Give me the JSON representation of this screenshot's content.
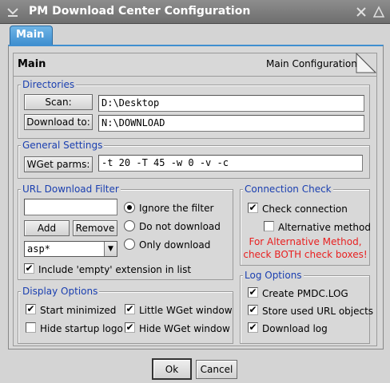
{
  "window": {
    "title": "PM Download Center Configuration"
  },
  "titlebar_icons": {
    "left": "chevron-down-icon",
    "close": "close-icon",
    "restore": "restore-icon"
  },
  "tabs": [
    {
      "label": "Main"
    }
  ],
  "main": {
    "heading": "Main",
    "section_label": "Main Configuration"
  },
  "directories": {
    "legend": "Directories",
    "scan_label": "Scan:",
    "scan_value": "D:\\Desktop",
    "download_label": "Download to:",
    "download_value": "N:\\DOWNLOAD"
  },
  "general": {
    "legend": "General Settings",
    "wget_label": "WGet parms:",
    "wget_value": "-t 20 -T 45 -w 0 -v -c"
  },
  "url_filter": {
    "legend": "URL Download Filter",
    "input_value": "",
    "add_label": "Add",
    "remove_label": "Remove",
    "select_value": "asp*",
    "radios": [
      {
        "label": "Ignore the filter",
        "checked": true
      },
      {
        "label": "Do not download",
        "checked": false
      },
      {
        "label": "Only download",
        "checked": false
      }
    ],
    "include_empty": {
      "label": "Include 'empty' extension in list",
      "checked": true
    }
  },
  "connection": {
    "legend": "Connection Check",
    "check_connection": {
      "label": "Check connection",
      "checked": true
    },
    "alternative": {
      "label": "Alternative method",
      "checked": false
    },
    "note_line1": "For Alternative Method,",
    "note_line2": "check BOTH check boxes!",
    "note_color": "#e82020"
  },
  "display": {
    "legend": "Display Options",
    "start_minimized": {
      "label": "Start minimized",
      "checked": true
    },
    "hide_startup_logo": {
      "label": "Hide startup logo",
      "checked": false
    },
    "little_wget": {
      "label": "Little WGet window",
      "checked": true
    },
    "hide_wget": {
      "label": "Hide WGet window",
      "checked": true
    }
  },
  "log": {
    "legend": "Log Options",
    "create_log": {
      "label": "Create PMDC.LOG",
      "checked": true
    },
    "store_url": {
      "label": "Store used URL objects",
      "checked": true
    },
    "download_log": {
      "label": "Download log",
      "checked": true
    }
  },
  "footer": {
    "ok_label": "Ok",
    "cancel_label": "Cancel"
  },
  "colors": {
    "tab_accent": "#3f8fd0",
    "legend_text": "#1a3fb0"
  }
}
